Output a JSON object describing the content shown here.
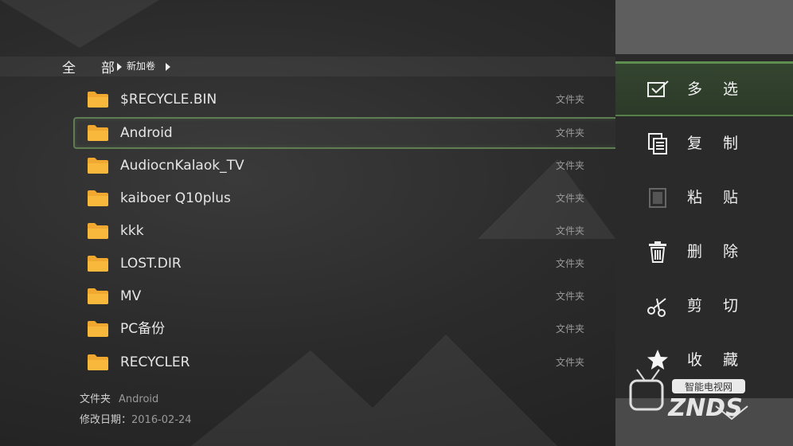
{
  "breadcrumb": {
    "root": "全部",
    "root_a": "全",
    "root_b": "部",
    "volume": "新加卷"
  },
  "files": [
    {
      "name": "$RECYCLE.BIN",
      "type": "文件夹"
    },
    {
      "name": "Android",
      "type": "文件夹",
      "focused": true
    },
    {
      "name": "AudiocnKalaok_TV",
      "type": "文件夹"
    },
    {
      "name": "kaiboer Q10plus",
      "type": "文件夹"
    },
    {
      "name": "kkk",
      "type": "文件夹"
    },
    {
      "name": "LOST.DIR",
      "type": "文件夹"
    },
    {
      "name": "MV",
      "type": "文件夹"
    },
    {
      "name": "PC备份",
      "type": "文件夹"
    },
    {
      "name": "RECYCLER",
      "type": "文件夹"
    }
  ],
  "info": {
    "type_label": "文件夹",
    "type_value": "Android",
    "date_label": "修改日期：",
    "date_value": "2016-02-24"
  },
  "menu": [
    {
      "label": "多选",
      "icon": "checkbox-icon",
      "selected": true
    },
    {
      "label": "复制",
      "icon": "copy-icon"
    },
    {
      "label": "粘贴",
      "icon": "paste-icon",
      "dim": true
    },
    {
      "label": "删除",
      "icon": "trash-icon"
    },
    {
      "label": "剪切",
      "icon": "scissors-icon"
    },
    {
      "label": "收藏",
      "icon": "star-icon"
    }
  ],
  "watermark": {
    "brand": "ZNDS",
    "tagline": "智能电视网"
  },
  "colors": {
    "accent": "#5e8f4e",
    "folder": "#f0a830",
    "panel": "#2a2a2a"
  }
}
